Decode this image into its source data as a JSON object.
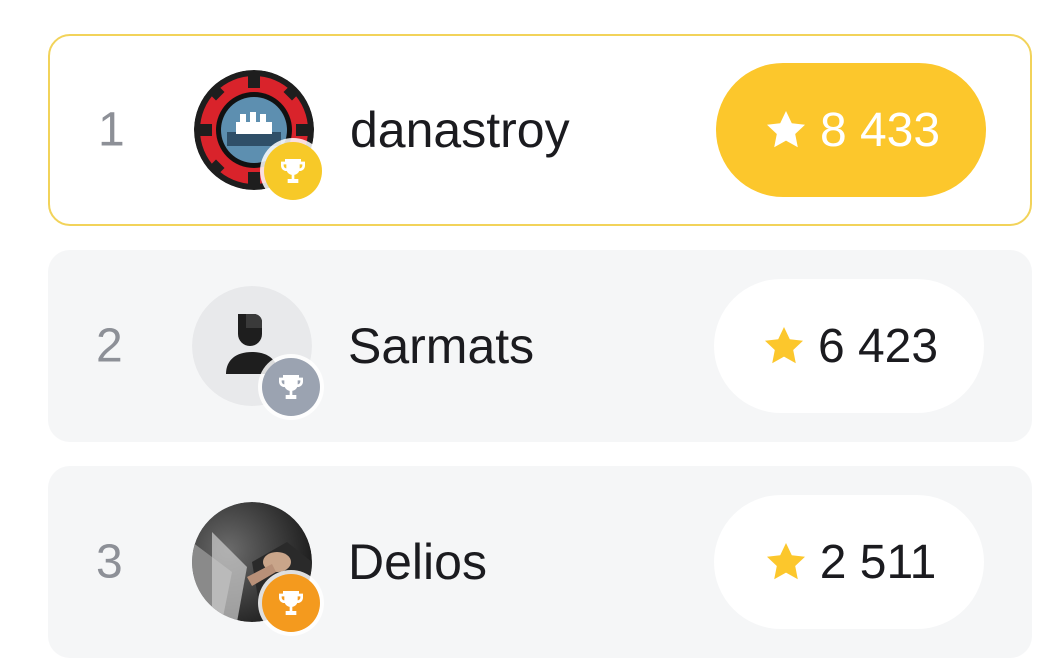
{
  "leaderboard": [
    {
      "rank": "1",
      "name": "danastroy",
      "score": "8 433",
      "avatar": "casino-chip-logo",
      "badge": "gold-trophy-icon"
    },
    {
      "rank": "2",
      "name": "Sarmats",
      "score": "6 423",
      "avatar": "default-user-avatar",
      "badge": "silver-trophy-icon"
    },
    {
      "rank": "3",
      "name": "Delios",
      "score": "2 511",
      "avatar": "user-photo-avatar",
      "badge": "bronze-trophy-icon"
    }
  ],
  "colors": {
    "gold": "#fcc72c",
    "silver": "#9ba3b1",
    "bronze": "#f49a1e",
    "highlight_border": "#f2d35a",
    "row_background": "#f5f6f7"
  }
}
